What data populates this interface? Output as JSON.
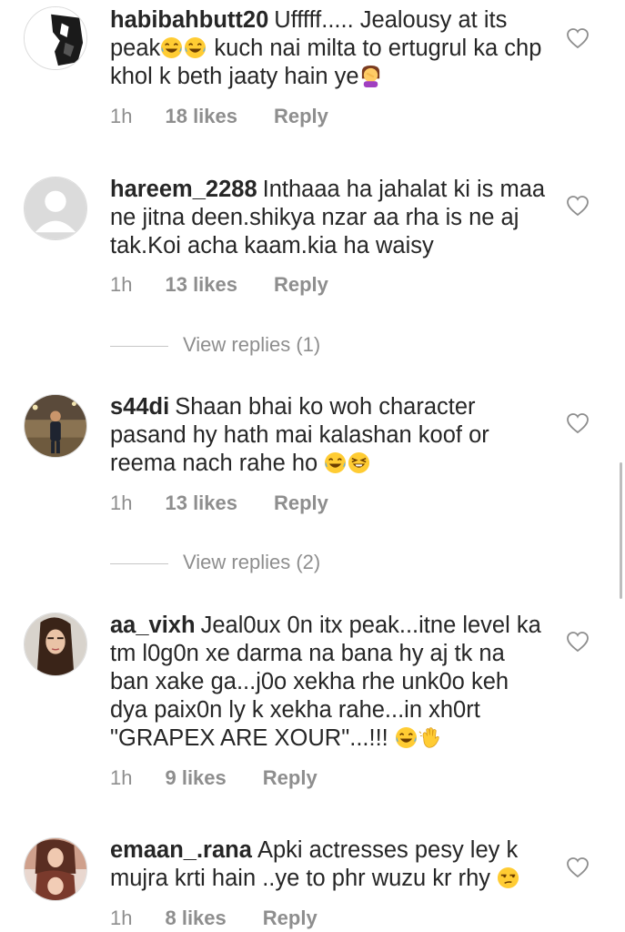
{
  "comments": [
    {
      "username": "habibahbutt20",
      "text_parts": [
        "Ufffff..... Jealousy at its peak",
        "kuch nai milta to ertugrul ka chp khol k beth jaaty hain ye"
      ],
      "emojis": [
        "joy-emoji",
        "joy-emoji",
        "facepalm-emoji"
      ],
      "time": "1h",
      "likes": "18 likes",
      "reply": "Reply"
    },
    {
      "username": "hareem_2288",
      "text": "Inthaaa ha jahalat ki is maa ne jitna deen.shikya nzar aa rha is ne aj tak.Koi acha kaam.kia ha waisy",
      "time": "1h",
      "likes": "13 likes",
      "reply": "Reply",
      "view_replies": "View replies (1)"
    },
    {
      "username": "s44di",
      "text": "Shaan bhai ko woh character pasand hy hath mai kalashan koof or reema nach rahe ho",
      "emojis": [
        "joy-emoji",
        "laughing-emoji"
      ],
      "time": "1h",
      "likes": "13 likes",
      "reply": "Reply",
      "view_replies": "View replies (2)"
    },
    {
      "username": "aa_vixh",
      "text": "Jeal0ux 0n itx peak...itne level ka tm l0g0n xe darma na bana hy aj tk na ban xake ga...j0o xekha rhe unk0o keh dya paix0n ly k xekha rahe...in xh0rt \"GRAPEX ARE XOUR\"...!!!",
      "emojis": [
        "joy-emoji",
        "waving-hand-emoji"
      ],
      "time": "1h",
      "likes": "9 likes",
      "reply": "Reply"
    },
    {
      "username": "emaan_.rana",
      "text": "Apki actresses pesy ley k mujra krti hain ..ye to phr wuzu kr rhy",
      "emojis": [
        "unamused-emoji"
      ],
      "time": "1h",
      "likes": "8 likes",
      "reply": "Reply"
    }
  ],
  "colors": {
    "text": "#262626",
    "secondary": "#8e8e8e",
    "divider": "#c7c7c7",
    "emoji_yellow": "#ffcc33"
  }
}
